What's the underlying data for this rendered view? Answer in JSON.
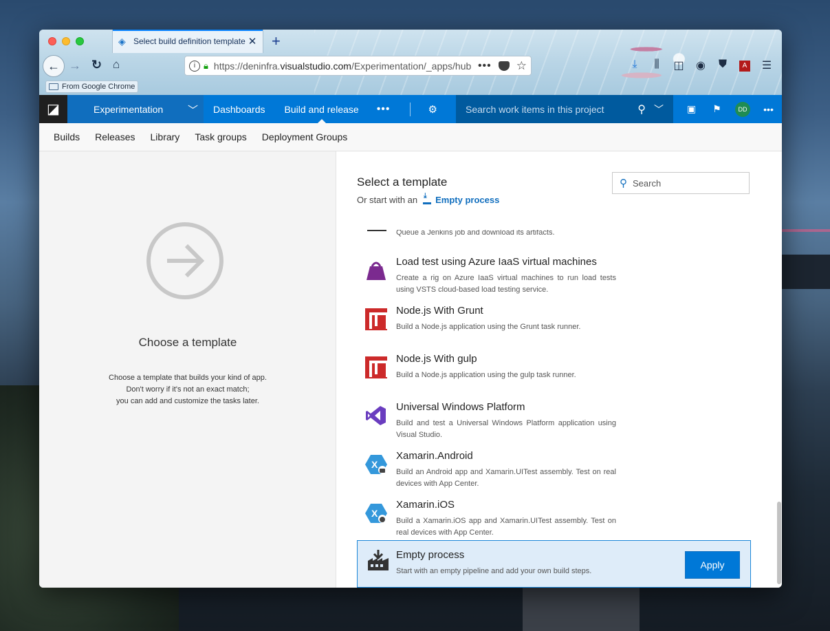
{
  "browser": {
    "tab_title": "Select build definition template",
    "tab_close": "✕",
    "new_tab": "+",
    "url_host_prefix": "https://deninfra.",
    "url_host": "visualstudio.com",
    "url_path": "/Experimentation/_apps/hub",
    "url_more": "•••",
    "bookmark_label": "From Google Chrome"
  },
  "topnav": {
    "project": "Experimentation",
    "links": [
      "Dashboards",
      "Build and release"
    ],
    "more": "•••",
    "search_placeholder": "Search work items in this project",
    "avatar_initials": "DD",
    "overflow": "•••"
  },
  "subnav": {
    "items": [
      "Builds",
      "Releases",
      "Library",
      "Task groups",
      "Deployment Groups"
    ]
  },
  "left_panel": {
    "title": "Choose a template",
    "desc_line1": "Choose a template that builds your kind of app.",
    "desc_line2": "Don't worry if it's not an exact match;",
    "desc_line3": "you can add and customize the tasks later."
  },
  "right_panel": {
    "title": "Select a template",
    "or_text": "Or start with an",
    "empty_link": "Empty process",
    "search_placeholder": "Search"
  },
  "templates": [
    {
      "name": "",
      "desc": "Queue a Jenkins job and download its artifacts."
    },
    {
      "name": "Load test using Azure IaaS virtual machines",
      "desc": "Create a rig on Azure IaaS virtual machines to run load tests using VSTS cloud-based load testing service."
    },
    {
      "name": "Node.js With Grunt",
      "desc": "Build a Node.js application using the Grunt task runner."
    },
    {
      "name": "Node.js With gulp",
      "desc": "Build a Node.js application using the gulp task runner."
    },
    {
      "name": "Universal Windows Platform",
      "desc": "Build and test a Universal Windows Platform application using Visual Studio."
    },
    {
      "name": "Xamarin.Android",
      "desc": "Build an Android app and Xamarin.UITest assembly. Test on real devices with App Center."
    },
    {
      "name": "Xamarin.iOS",
      "desc": "Build a Xamarin.iOS app and Xamarin.UITest assembly. Test on real devices with App Center."
    }
  ],
  "selected_template": {
    "name": "Empty process",
    "desc": "Start with an empty pipeline and add your own build steps.",
    "apply_label": "Apply"
  },
  "colors": {
    "accent": "#0078d7",
    "selected_bg": "#deecf9",
    "grunt_red": "#cc2a2a",
    "load_test_purple": "#7b2a8f",
    "vs_purple": "#6a3dbf",
    "xamarin_blue": "#3498db"
  }
}
